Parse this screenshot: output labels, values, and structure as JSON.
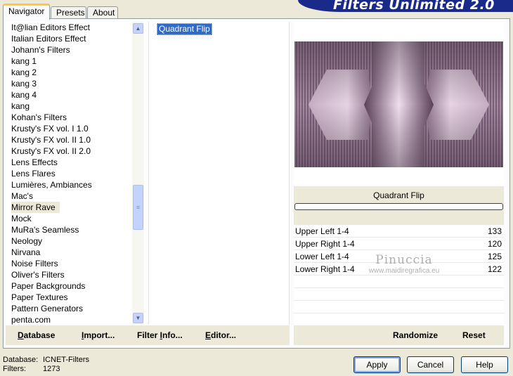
{
  "tabs": [
    {
      "label": "Navigator",
      "active": true
    },
    {
      "label": "Presets",
      "active": false
    },
    {
      "label": "About",
      "active": false
    }
  ],
  "banner_title": "Filters Unlimited 2.0",
  "categories": [
    "It@lian Editors Effect",
    "Italian Editors Effect",
    "Johann's Filters",
    "kang 1",
    "kang 2",
    "kang 3",
    "kang 4",
    "kang",
    "Kohan's Filters",
    "Krusty's FX vol. I 1.0",
    "Krusty's FX vol. II 1.0",
    "Krusty's FX vol. II 2.0",
    "Lens Effects",
    "Lens Flares",
    "Lumières, Ambiances",
    "Mac's",
    "Mirror Rave",
    "Mock",
    "MuRa's Seamless",
    "Neology",
    "Nirvana",
    "Noise Filters",
    "Oliver's Filters",
    "Paper Backgrounds",
    "Paper Textures",
    "Pattern Generators",
    "penta.com"
  ],
  "selected_category": "Mirror Rave",
  "filters": [
    "Quadrant Flip"
  ],
  "selected_filter": "Quadrant Flip",
  "tools": [
    {
      "label": "Database",
      "u": "D",
      "rest": "atabase"
    },
    {
      "label": "Import...",
      "u": "I",
      "rest": "mport..."
    },
    {
      "label": "Filter Info...",
      "u": "",
      "pre": "Filter ",
      "mid": "I",
      "post": "nfo..."
    },
    {
      "label": "Editor...",
      "u": "E",
      "rest": "ditor..."
    }
  ],
  "filter_name": "Quadrant Flip",
  "params": [
    {
      "label": "Upper Left 1-4",
      "value": "133"
    },
    {
      "label": "Upper Right 1-4",
      "value": "120"
    },
    {
      "label": "Lower Left 1-4",
      "value": "125"
    },
    {
      "label": "Lower Right 1-4",
      "value": "122"
    }
  ],
  "randomize_label": "Randomize",
  "reset_label": "Reset",
  "watermark": {
    "name": "Pinuccia",
    "url": "www.maidiregrafica.eu"
  },
  "status": {
    "database_label": "Database:",
    "database_value": "ICNET-Filters",
    "filters_label": "Filters:",
    "filters_value": "1273"
  },
  "buttons": {
    "apply": "Apply",
    "cancel": "Cancel",
    "help": "Help"
  },
  "colors": {
    "accent": "#316ac5",
    "banner": "#1a2a8a",
    "preview_purple": "#8a6f8a"
  }
}
